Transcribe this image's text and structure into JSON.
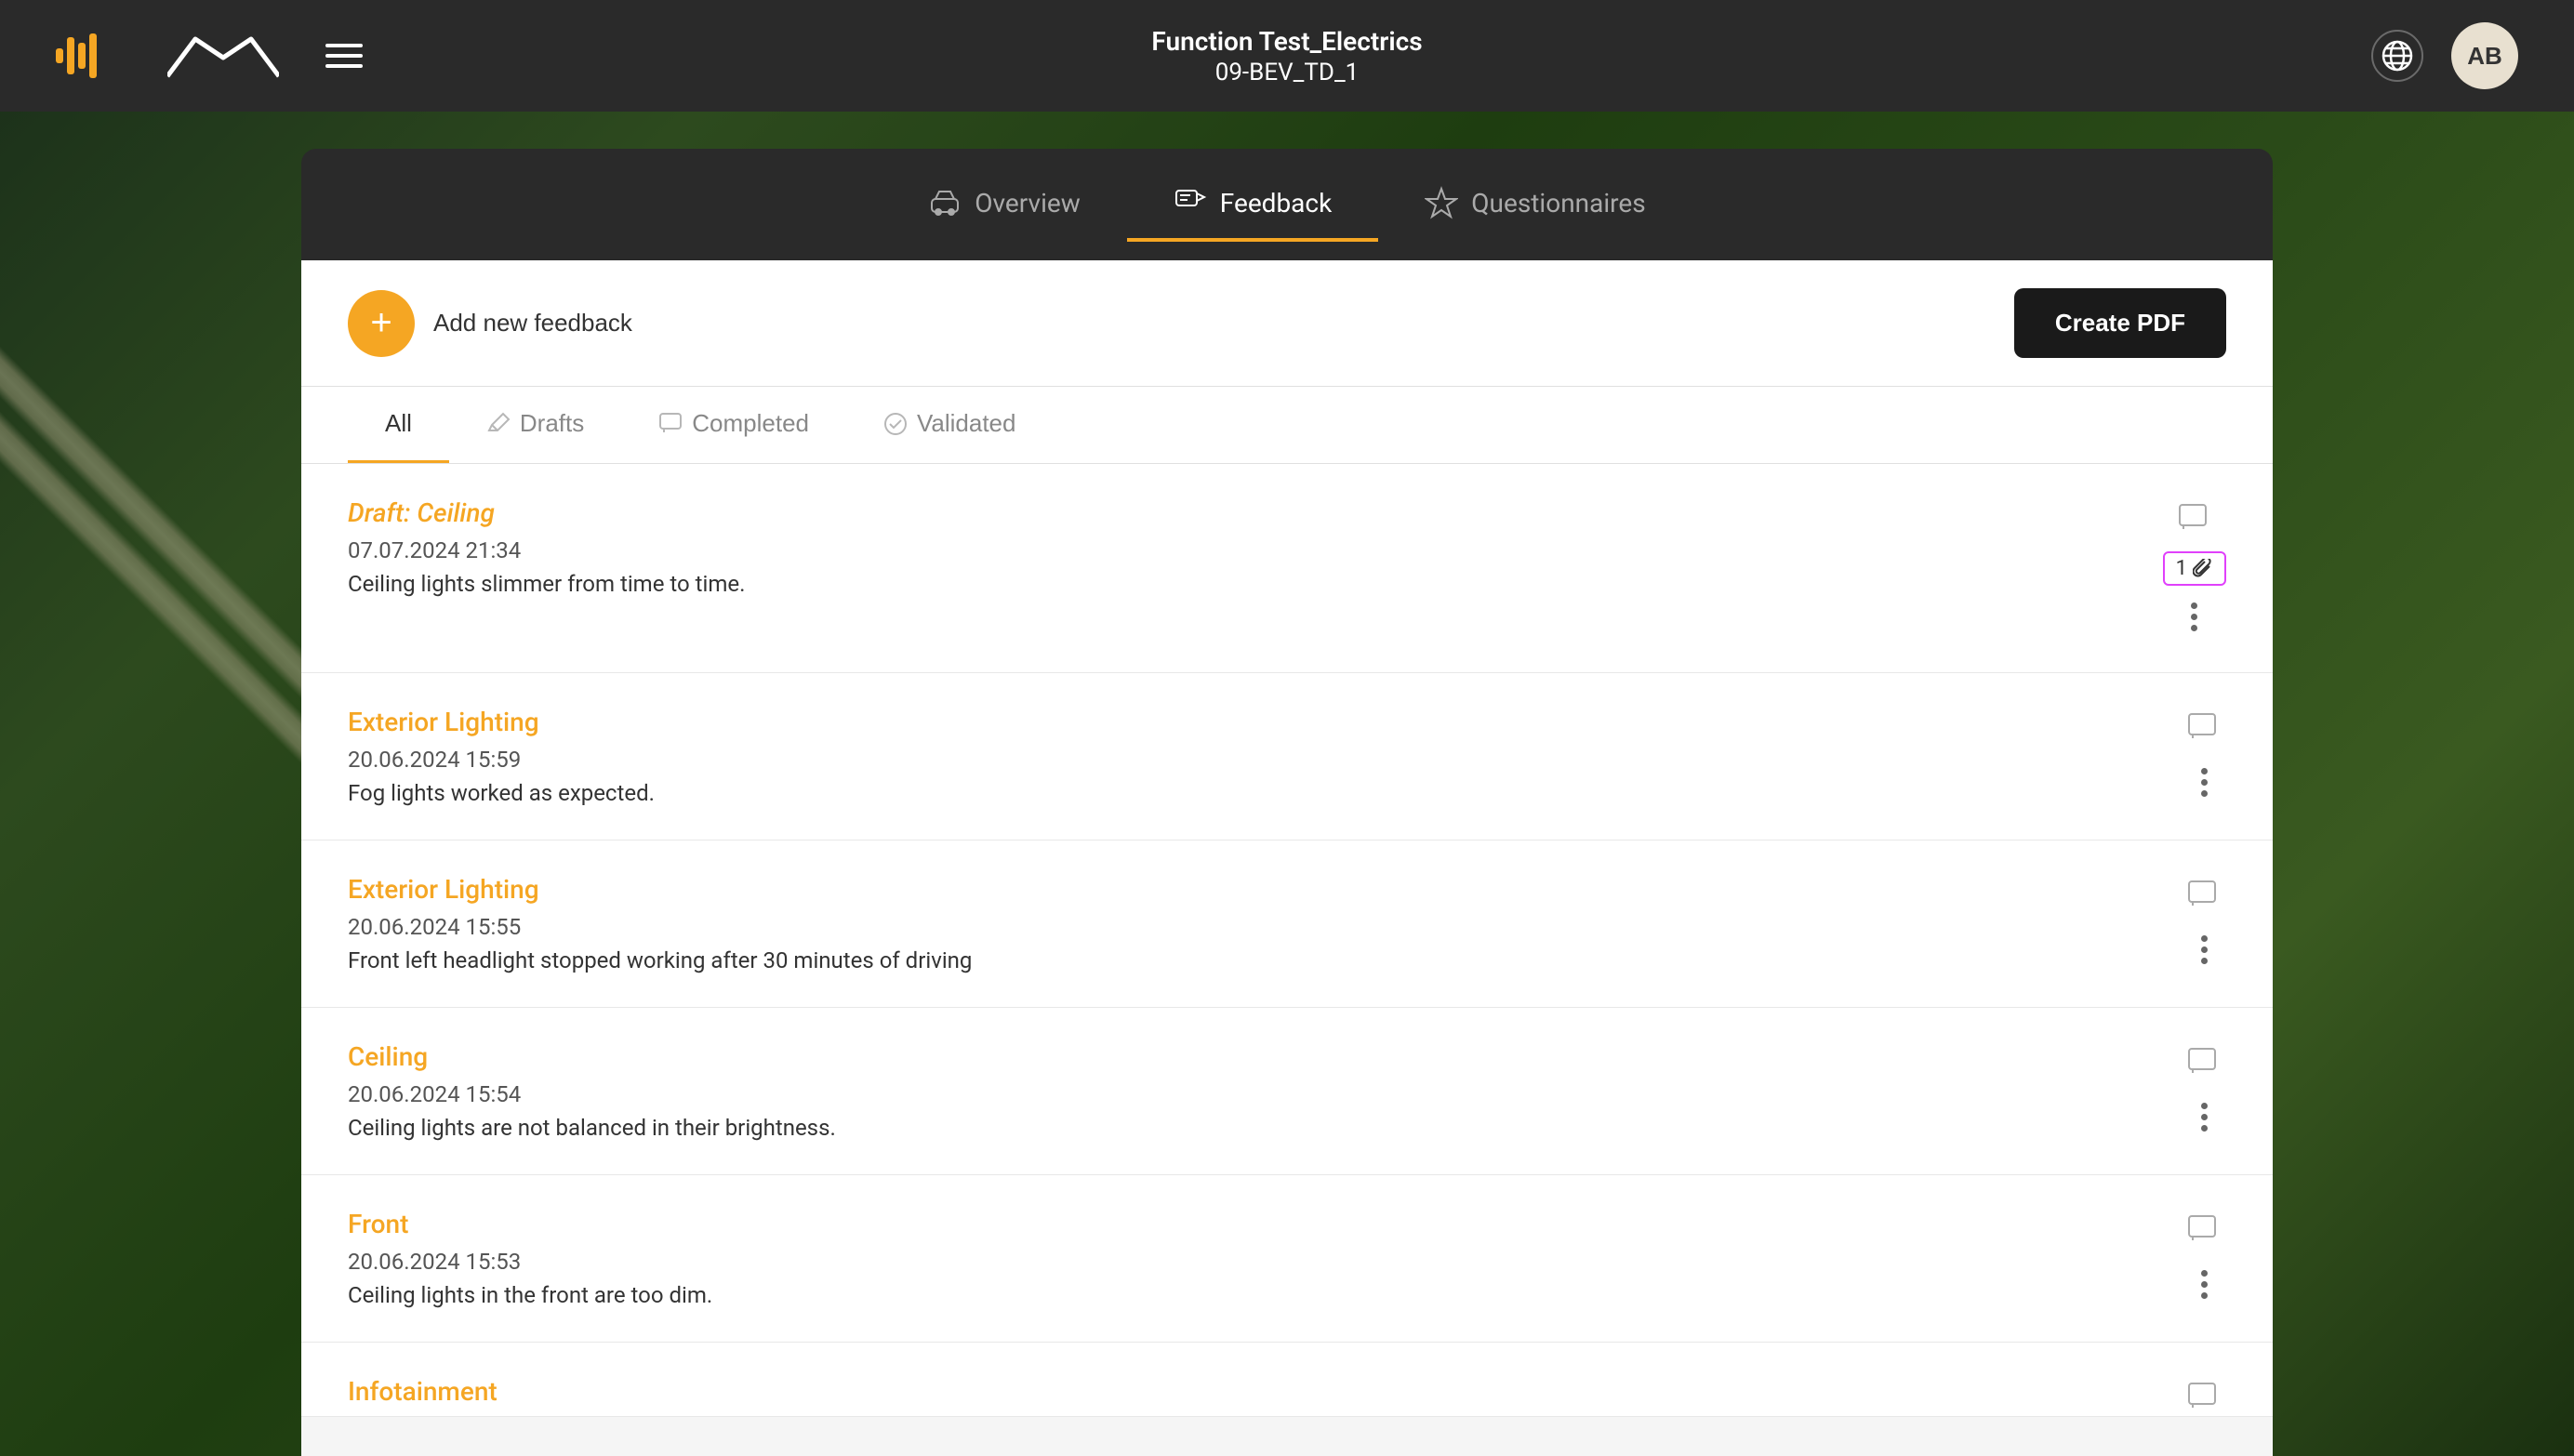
{
  "app": {
    "title": "Function Test_Electrics",
    "subtitle": "09-BEV_TD_1",
    "user_initials": "AB"
  },
  "nav": {
    "tabs": [
      {
        "id": "overview",
        "label": "Overview",
        "icon": "car-icon"
      },
      {
        "id": "feedback",
        "label": "Feedback",
        "icon": "feedback-icon",
        "active": true
      },
      {
        "id": "questionnaires",
        "label": "Questionnaires",
        "icon": "star-icon"
      }
    ]
  },
  "feedback": {
    "add_label": "Add new feedback",
    "create_pdf_label": "Create PDF",
    "filter_tabs": [
      {
        "id": "all",
        "label": "All",
        "active": true
      },
      {
        "id": "drafts",
        "label": "Drafts",
        "icon": "pencil-icon"
      },
      {
        "id": "completed",
        "label": "Completed",
        "icon": "chat-icon"
      },
      {
        "id": "validated",
        "label": "Validated",
        "icon": "validate-icon"
      }
    ],
    "items": [
      {
        "id": 1,
        "title": "Draft: Ceiling",
        "is_draft": true,
        "date": "07.07.2024 21:34",
        "description": "Ceiling lights slimmer from time to time.",
        "attachment_count": 1,
        "has_comment": true,
        "has_attachment_badge": true
      },
      {
        "id": 2,
        "title": "Exterior Lighting",
        "is_draft": false,
        "date": "20.06.2024 15:59",
        "description": "Fog lights worked as expected.",
        "has_comment": true,
        "has_attachment_badge": false
      },
      {
        "id": 3,
        "title": "Exterior Lighting",
        "is_draft": false,
        "date": "20.06.2024 15:55",
        "description": "Front left headlight stopped working after 30 minutes of driving",
        "has_comment": true,
        "has_attachment_badge": false
      },
      {
        "id": 4,
        "title": "Ceiling",
        "is_draft": false,
        "date": "20.06.2024 15:54",
        "description": "Ceiling lights are not balanced in their brightness.",
        "has_comment": true,
        "has_attachment_badge": false
      },
      {
        "id": 5,
        "title": "Front",
        "is_draft": false,
        "date": "20.06.2024 15:53",
        "description": "Ceiling lights in the front are too dim.",
        "has_comment": true,
        "has_attachment_badge": false
      },
      {
        "id": 6,
        "title": "Infotainment",
        "is_draft": false,
        "date": "",
        "description": "",
        "has_comment": true,
        "has_attachment_badge": false,
        "partial": true
      }
    ]
  }
}
